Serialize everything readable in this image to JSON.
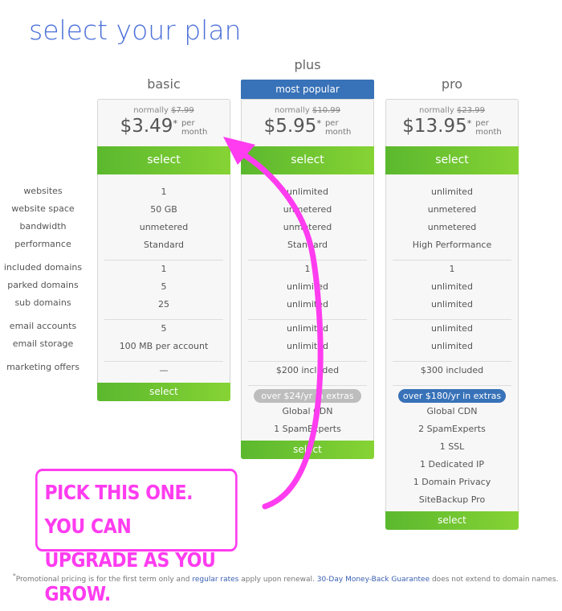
{
  "page": {
    "title": "select your plan"
  },
  "labels": [
    [
      "websites",
      "website space",
      "bandwidth",
      "performance"
    ],
    [
      "included domains",
      "parked domains",
      "sub domains"
    ],
    [
      "email accounts",
      "email storage"
    ],
    [
      "marketing offers"
    ]
  ],
  "plans": [
    {
      "name": "basic",
      "normally": "normally",
      "old_price": "$7.99",
      "price": "$3.49",
      "star": "*",
      "per1": "per",
      "per2": "month",
      "select": "select",
      "groups": [
        [
          "1",
          "50 GB",
          "unmetered",
          "Standard"
        ],
        [
          "1",
          "5",
          "25"
        ],
        [
          "5",
          "100 MB per account"
        ],
        [
          "—"
        ]
      ],
      "bottom_select": "select"
    },
    {
      "name": "plus",
      "tag": "most popular",
      "normally": "normally",
      "old_price": "$10.99",
      "price": "$5.95",
      "star": "*",
      "per1": "per",
      "per2": "month",
      "select": "select",
      "groups": [
        [
          "unlimited",
          "unmetered",
          "unmetered",
          "Standard"
        ],
        [
          "1",
          "unlimited",
          "unlimited"
        ],
        [
          "unlimited",
          "unlimited"
        ],
        [
          "$200 included"
        ]
      ],
      "badge": "over $24/yr in extras",
      "badge_color": "#bdbdbd",
      "extras": [
        "Global CDN",
        "1 SpamExperts"
      ],
      "bottom_select": "select"
    },
    {
      "name": "pro",
      "normally": "normally",
      "old_price": "$23.99",
      "price": "$13.95",
      "star": "*",
      "per1": "per",
      "per2": "month",
      "select": "select",
      "groups": [
        [
          "unlimited",
          "unmetered",
          "unmetered",
          "High Performance"
        ],
        [
          "1",
          "unlimited",
          "unlimited"
        ],
        [
          "unlimited",
          "unlimited"
        ],
        [
          "$300 included"
        ]
      ],
      "badge": "over $180/yr in extras",
      "badge_color": "#3872b8",
      "extras": [
        "Global CDN",
        "2 SpamExperts",
        "1 SSL",
        "1 Dedicated IP",
        "1 Domain Privacy",
        "SiteBackup Pro"
      ],
      "bottom_select": "select"
    }
  ],
  "footnote": {
    "star": "*",
    "t1": "Promotional pricing is for the first term only and ",
    "link1": "regular rates",
    "t2": " apply upon renewal. ",
    "link2": "30-Day Money-Back Guarantee",
    "t3": " does not extend to domain names."
  },
  "annotation": {
    "line1": "PICK THIS ONE.  YOU CAN",
    "line2": "UPGRADE AS YOU GROW.",
    "color": "#ff3cf0"
  },
  "colors": {
    "title": "#4a6fd8",
    "select_green": "#6cc531",
    "popular_blue": "#3872b8"
  }
}
